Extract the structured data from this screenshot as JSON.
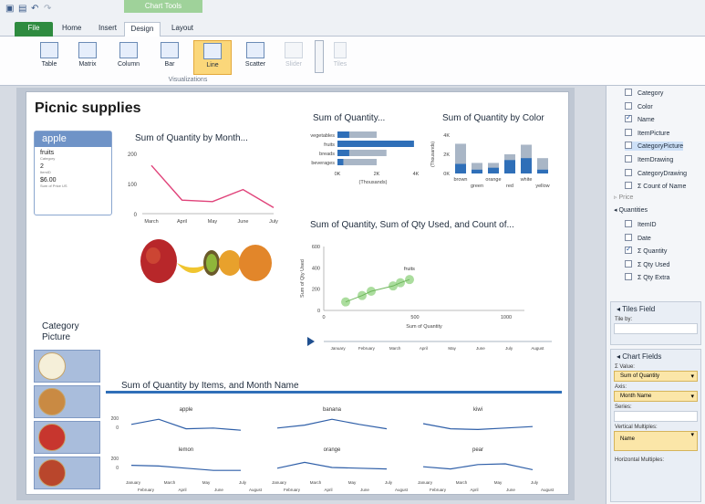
{
  "ribbon": {
    "context_tab": "Chart Tools",
    "tabs": {
      "file": "File",
      "home": "Home",
      "insert": "Insert",
      "design": "Design",
      "layout": "Layout"
    },
    "buttons": {
      "table": "Table",
      "matrix": "Matrix",
      "column": "Column",
      "bar": "Bar",
      "line": "Line",
      "scatter": "Scatter",
      "slider": "Slider",
      "tiles": "Tiles"
    },
    "group_label": "Visualizations"
  },
  "report": {
    "title": "Picnic supplies",
    "card": {
      "name": "apple",
      "category": "fruits",
      "category_label": "Category",
      "item_id": "2",
      "item_id_label": "ItemID",
      "price": "$6.00",
      "price_label": "Sum of Price US"
    },
    "line_chart_title": "Sum of Quantity by Month...",
    "bar_chart_title": "Sum of Quantity...",
    "column_chart_title": "Sum of Quantity by Color",
    "scatter_title": "Sum of Quantity, Sum of Qty Used, and Count of...",
    "multiples_title": "Sum of Quantity by Items, and Month Name",
    "category_picture_label": "Category\nPicture"
  },
  "chart_data": [
    {
      "type": "line",
      "title": "Sum of Quantity by Month...",
      "categories": [
        "March",
        "April",
        "May",
        "June",
        "July"
      ],
      "values": [
        160,
        45,
        40,
        80,
        20
      ],
      "yticks": [
        "200",
        "100",
        "0"
      ],
      "ylim": [
        0,
        200
      ],
      "color": "#e0437a"
    },
    {
      "type": "bar",
      "title": "Sum of Quantity...",
      "categories": [
        "vegetables",
        "fruits",
        "breads",
        "beverages"
      ],
      "values": [
        2000,
        3900,
        2500,
        2000
      ],
      "highlight": [
        600,
        3900,
        600,
        300
      ],
      "xticks": [
        "0K",
        "2K",
        "4K"
      ],
      "xlabel": "(Thousands)",
      "xlim": [
        0,
        4000
      ]
    },
    {
      "type": "bar",
      "title": "Sum of Quantity by Color",
      "categories": [
        "brown",
        "green",
        "orange",
        "red",
        "white",
        "yellow"
      ],
      "values": [
        3.1,
        1.1,
        1.1,
        2.0,
        3.0,
        1.6
      ],
      "highlight": [
        1.0,
        0.4,
        0.6,
        1.4,
        1.6,
        0.4
      ],
      "yticks": [
        "4K",
        "2K",
        "0K"
      ],
      "ylabel": "(Thousands)",
      "ylim": [
        0,
        4
      ]
    },
    {
      "type": "scatter",
      "title": "Sum of Quantity, Sum of Qty Used, and Count of...",
      "xlabel": "Sum of Quantity",
      "ylabel": "Sum of Qty Used",
      "xticks": [
        "0",
        "500",
        "1000"
      ],
      "yticks": [
        "600",
        "400",
        "200",
        "0"
      ],
      "xlim": [
        0,
        1100
      ],
      "ylim": [
        0,
        600
      ],
      "points": [
        [
          120,
          80
        ],
        [
          210,
          140
        ],
        [
          260,
          180
        ],
        [
          380,
          230
        ],
        [
          420,
          260
        ],
        [
          470,
          290
        ]
      ],
      "annotation": "fruits",
      "play_axis": [
        "January",
        "February",
        "March",
        "April",
        "May",
        "June",
        "July",
        "August"
      ]
    },
    {
      "type": "line",
      "title": "Sum of Quantity by Items, and Month Name",
      "panels": [
        {
          "name": "apple",
          "values": [
            90,
            160,
            30,
            40,
            10
          ]
        },
        {
          "name": "banana",
          "values": [
            40,
            80,
            160,
            90,
            30
          ]
        },
        {
          "name": "kiwi",
          "values": [
            100,
            30,
            20,
            40,
            60
          ]
        },
        {
          "name": "lemon",
          "values": [
            80,
            70,
            40,
            10,
            10
          ]
        },
        {
          "name": "orange",
          "values": [
            40,
            120,
            50,
            40,
            30
          ]
        },
        {
          "name": "pear",
          "values": [
            60,
            30,
            90,
            100,
            20
          ]
        }
      ],
      "yticks": [
        "200",
        "0"
      ],
      "xticks_top": [
        "January",
        "March",
        "May",
        "July"
      ],
      "xticks_bottom": [
        "February",
        "April",
        "June",
        "August"
      ]
    }
  ],
  "field_list": {
    "items": [
      {
        "label": "Category",
        "checked": false
      },
      {
        "label": "Color",
        "checked": false
      },
      {
        "label": "Name",
        "checked": true
      },
      {
        "label": "ItemPicture",
        "checked": false
      },
      {
        "label": "CategoryPicture",
        "checked": false,
        "selected": true
      },
      {
        "label": "ItemDrawing",
        "checked": false
      },
      {
        "label": "CategoryDrawing",
        "checked": false
      },
      {
        "label": "Σ Count of Name",
        "checked": false
      }
    ],
    "group_price": "Price",
    "group_quantities": "Quantities",
    "quantities": [
      {
        "label": "ItemID",
        "checked": false
      },
      {
        "label": "Date",
        "checked": false
      },
      {
        "label": "Σ Quantity",
        "checked": true
      },
      {
        "label": "Σ Qty Used",
        "checked": false
      },
      {
        "label": "Σ Qty Extra",
        "checked": false
      }
    ]
  },
  "tiles_field": {
    "header": "Tiles Field",
    "tile_by": "Tile by:"
  },
  "chart_fields": {
    "header": "Chart Fields",
    "value_label": "Σ Value:",
    "value": "Sum of Quantity",
    "axis_label": "Axis:",
    "axis": "Month Name",
    "series_label": "Series:",
    "vertical_label": "Vertical Multiples:",
    "vertical": "Name",
    "horizontal_label": "Horizontal Multiples:"
  },
  "colors": {
    "accent": "#2f6fb8",
    "line_pink": "#e0437a",
    "ribbon_green": "#2e8b3f",
    "highlight_bar": "#2f6fb8",
    "base_bar": "#a9b6c6"
  }
}
